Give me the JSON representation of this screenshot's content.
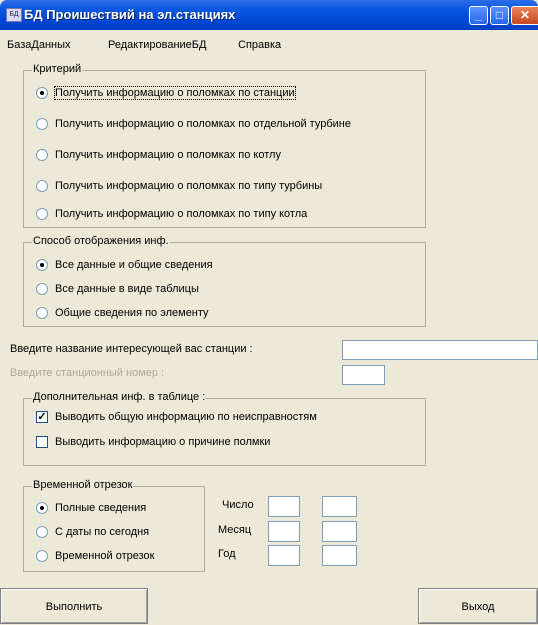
{
  "window": {
    "title": "БД Проишествий на эл.станциях",
    "app_icon": "app-icon",
    "minimize": "_",
    "maximize": "□",
    "close": "✕"
  },
  "menu": [
    "БазаДанных",
    "РедактированиеБД",
    "Справка"
  ],
  "criteria": {
    "legend": "Критерий",
    "options": [
      {
        "label": "Получить  информацию о поломках по  станции",
        "selected": true
      },
      {
        "label": "Получить  информацию о поломках по отдельной турбине",
        "selected": false
      },
      {
        "label": "Получить  информацию о поломках по котлу",
        "selected": false
      },
      {
        "label": "Получить  информацию о поломках по типу  турбины",
        "selected": false
      },
      {
        "label": "Получить  информацию о поломках по типу котла",
        "selected": false
      }
    ]
  },
  "display": {
    "legend": "Способ отображения инф.",
    "options": [
      {
        "label": "Все данные и общие сведения",
        "selected": true
      },
      {
        "label": "Все данные в виде таблицы",
        "selected": false
      },
      {
        "label": "Общие сведения по элементу",
        "selected": false
      }
    ]
  },
  "station_name": {
    "label": "Введите название  интересующей  вас  станции  :",
    "value": ""
  },
  "station_number": {
    "label": "Введите станционный номер  :",
    "value": "",
    "enabled": false
  },
  "table_extra": {
    "legend": "Дополнительная инф. в таблице :",
    "options": [
      {
        "label": "Выводить общую информацию по неисправностям",
        "checked": true
      },
      {
        "label": "Выводить информацию о причине полмки",
        "checked": false
      }
    ]
  },
  "period": {
    "legend": "Временной отрезок",
    "options": [
      {
        "label": "Полные  сведения",
        "selected": true
      },
      {
        "label": "С даты  по сегодня",
        "selected": false
      },
      {
        "label": "Временной отрезок",
        "selected": false
      }
    ],
    "fields": {
      "day": "Число",
      "month": "Месяц",
      "year": "Год"
    }
  },
  "buttons": {
    "execute": "Выполнить",
    "exit": "Выход"
  }
}
